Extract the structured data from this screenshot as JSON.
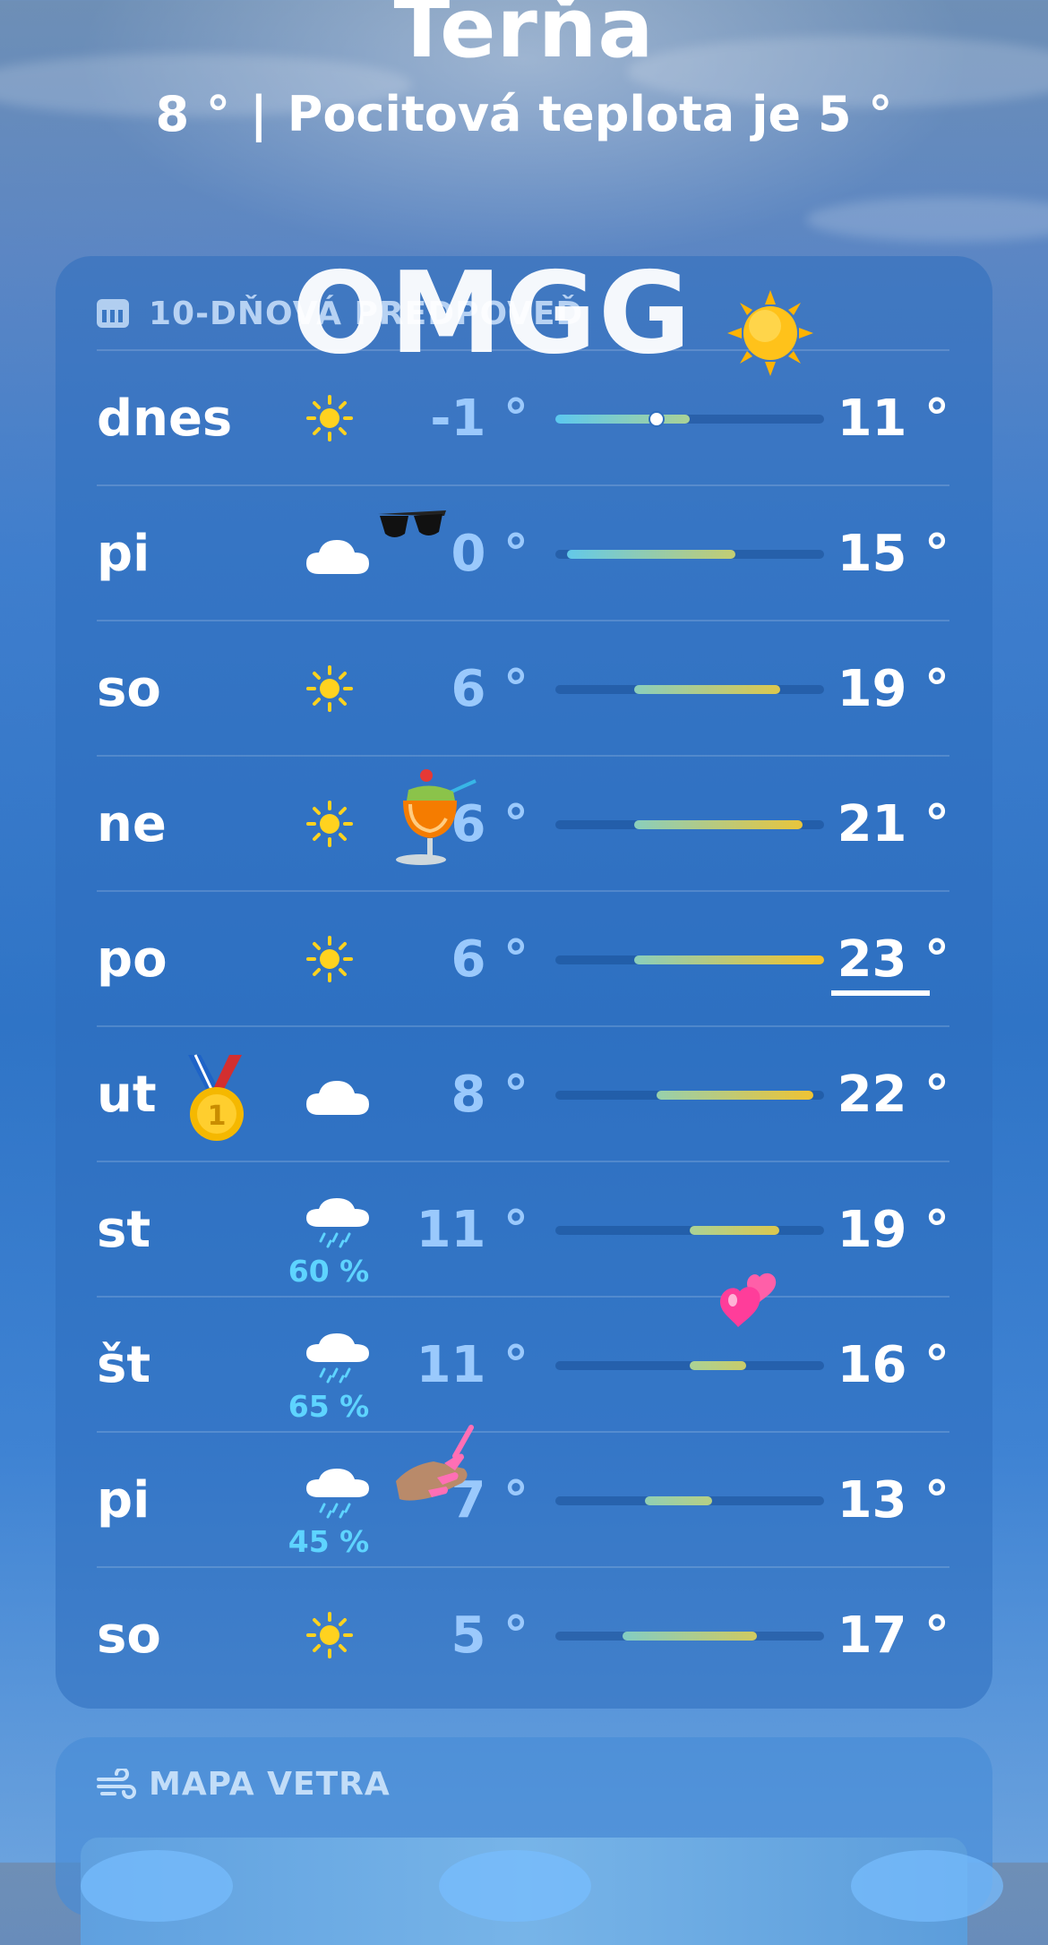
{
  "header": {
    "city": "Terňa",
    "current_temp": "8 °",
    "feels_like": "Pocitová teplota je 5 °"
  },
  "forecast": {
    "title": "10-DŇOVÁ PREDPOVEĎ",
    "days": [
      {
        "day": "dnes",
        "icon": "sun-icon",
        "low": "-1 °",
        "high": "11 °",
        "range": [
          -1,
          11
        ],
        "current": 8
      },
      {
        "day": "pi",
        "icon": "cloud-icon",
        "low": "0 °",
        "high": "15 °",
        "range": [
          0,
          15
        ]
      },
      {
        "day": "so",
        "icon": "sun-icon",
        "low": "6 °",
        "high": "19 °",
        "range": [
          6,
          19
        ]
      },
      {
        "day": "ne",
        "icon": "sun-icon",
        "low": "6 °",
        "high": "21 °",
        "range": [
          6,
          21
        ]
      },
      {
        "day": "po",
        "icon": "sun-icon",
        "low": "6 °",
        "high": "23 °",
        "range": [
          6,
          23
        ]
      },
      {
        "day": "ut",
        "icon": "cloud-icon",
        "low": "8 °",
        "high": "22 °",
        "range": [
          8,
          22
        ]
      },
      {
        "day": "st",
        "icon": "rain-cloud-icon",
        "precip": "60 %",
        "low": "11 °",
        "high": "19 °",
        "range": [
          11,
          19
        ]
      },
      {
        "day": "št",
        "icon": "rain-cloud-icon",
        "precip": "65 %",
        "low": "11 °",
        "high": "16 °",
        "range": [
          11,
          16
        ]
      },
      {
        "day": "pi",
        "icon": "rain-cloud-icon",
        "precip": "45 %",
        "low": "7 °",
        "high": "13 °",
        "range": [
          7,
          13
        ]
      },
      {
        "day": "so",
        "icon": "sun-icon",
        "low": "5 °",
        "high": "17 °",
        "range": [
          5,
          17
        ]
      }
    ],
    "scale": [
      -1,
      23
    ]
  },
  "overlay": {
    "text": "OMGG",
    "stickers": [
      "sun-sticker",
      "sunglasses-sticker",
      "tropical-drink-sticker",
      "medal-sticker",
      "hearts-sticker",
      "nail-polish-sticker"
    ]
  },
  "wind_map": {
    "title": "MAPA VETRA"
  },
  "colors": {
    "sun": "#ffd21f",
    "precip": "#5ed4ff",
    "cool": "#5cc8f0",
    "warm": "#f5c22a"
  }
}
